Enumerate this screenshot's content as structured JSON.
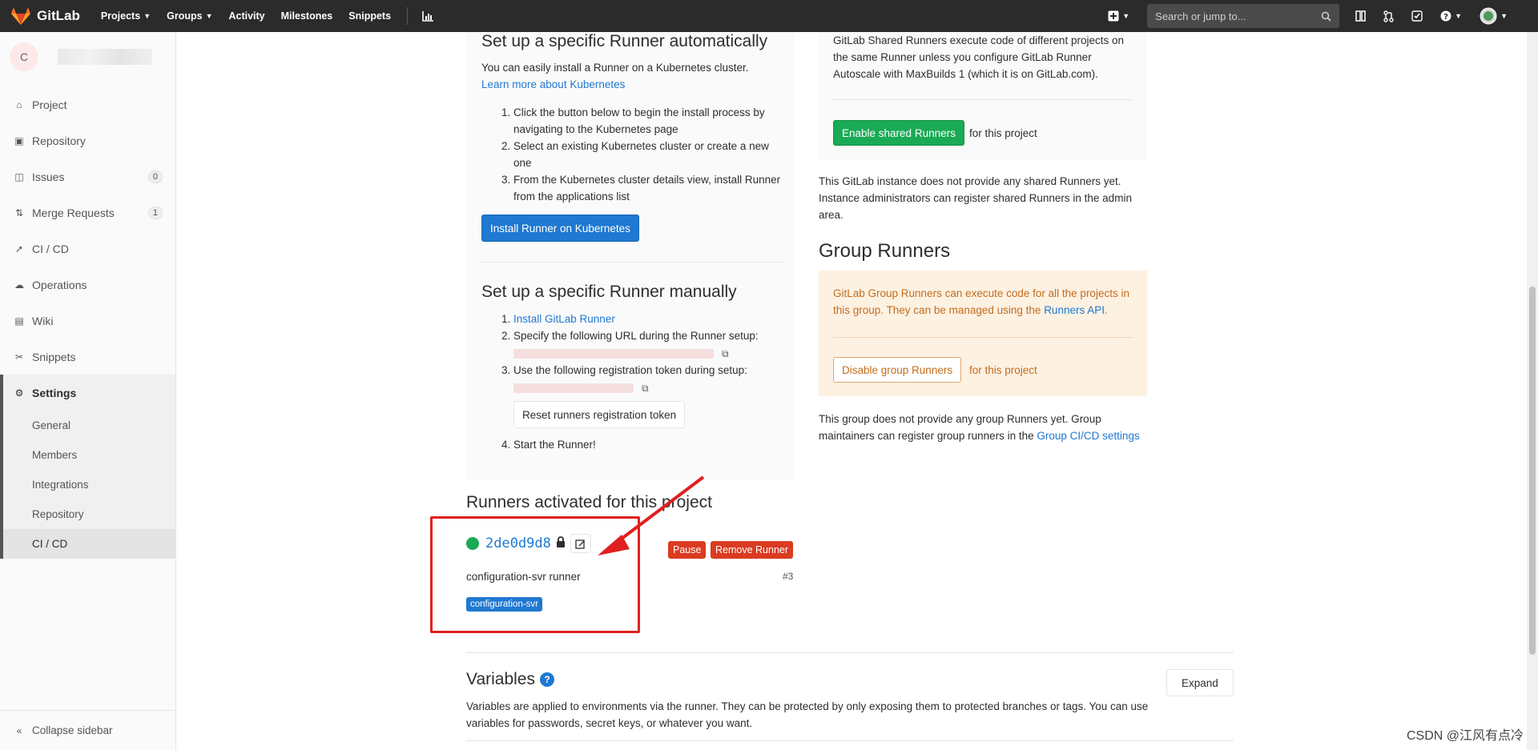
{
  "topbar": {
    "brand": "GitLab",
    "nav": [
      {
        "label": "Projects",
        "caret": true
      },
      {
        "label": "Groups",
        "caret": true
      },
      {
        "label": "Activity",
        "caret": false
      },
      {
        "label": "Milestones",
        "caret": false
      },
      {
        "label": "Snippets",
        "caret": false
      }
    ],
    "search_placeholder": "Search or jump to..."
  },
  "sidebar": {
    "avatar_letter": "C",
    "items": [
      {
        "label": "Project",
        "icon": "home-icon"
      },
      {
        "label": "Repository",
        "icon": "book-icon"
      },
      {
        "label": "Issues",
        "icon": "issues-icon",
        "badge": "0"
      },
      {
        "label": "Merge Requests",
        "icon": "merge-request-icon",
        "badge": "1"
      },
      {
        "label": "CI / CD",
        "icon": "rocket-icon"
      },
      {
        "label": "Operations",
        "icon": "cloud-gear-icon"
      },
      {
        "label": "Wiki",
        "icon": "wiki-icon"
      },
      {
        "label": "Snippets",
        "icon": "scissors-icon"
      }
    ],
    "settings": {
      "label": "Settings",
      "sub_items": [
        "General",
        "Members",
        "Integrations",
        "Repository",
        "CI / CD"
      ]
    },
    "collapse_label": "Collapse sidebar"
  },
  "auto_runner": {
    "title": "Set up a specific Runner automatically",
    "intro": "You can easily install a Runner on a Kubernetes cluster.",
    "learn_link": "Learn more about Kubernetes",
    "steps": [
      "Click the button below to begin the install process by navigating to the Kubernetes page",
      "Select an existing Kubernetes cluster or create a new one",
      "From the Kubernetes cluster details view, install Runner from the applications list"
    ],
    "install_button": "Install Runner on Kubernetes"
  },
  "manual_runner": {
    "title": "Set up a specific Runner manually",
    "step1_link": "Install GitLab Runner",
    "step2": "Specify the following URL during the Runner setup:",
    "step3": "Use the following registration token during setup:",
    "reset_button": "Reset runners registration token",
    "step4": "Start the Runner!"
  },
  "shared_runners": {
    "text": "GitLab Shared Runners execute code of different projects on the same Runner unless you configure GitLab Runner Autoscale with MaxBuilds 1 (which it is on GitLab.com).",
    "enable_button": "Enable shared Runners",
    "for_project": "for this project",
    "none_text": "This GitLab instance does not provide any shared Runners yet. Instance administrators can register shared Runners in the admin area."
  },
  "group_runners": {
    "title": "Group Runners",
    "info_prefix": "GitLab Group Runners can execute code for all the projects in this group. They can be managed using the ",
    "info_link": "Runners API",
    "info_suffix": ".",
    "disable_button": "Disable group Runners",
    "for_project": "for this project",
    "none_prefix": "This group does not provide any group Runners yet. Group maintainers can register group runners in the ",
    "none_link": "Group CI/CD settings"
  },
  "activated_runners": {
    "title": "Runners activated for this project",
    "runner_id": "2de0d9d8",
    "pause_button": "Pause",
    "remove_button": "Remove Runner",
    "description": "configuration-svr runner",
    "number": "#3",
    "tag": "configuration-svr"
  },
  "variables": {
    "title": "Variables",
    "expand_button": "Expand",
    "description": "Variables are applied to environments via the runner. They can be protected by only exposing them to protected branches or tags. You can use variables for passwords, secret keys, or whatever you want."
  },
  "watermark": "CSDN @江风有点冷",
  "colors": {
    "topbar": "#2b2b2b",
    "accent": "#1f78d1",
    "success": "#1aaa55",
    "danger": "#db3b21",
    "warning_bg": "#fdf1e2",
    "annotation": "#e02020"
  }
}
